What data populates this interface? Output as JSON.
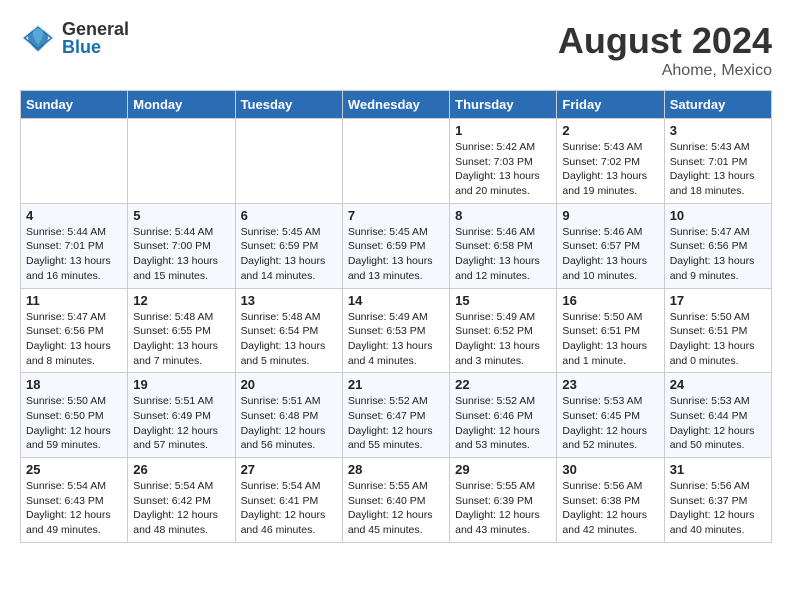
{
  "header": {
    "logo_general": "General",
    "logo_blue": "Blue",
    "month_year": "August 2024",
    "location": "Ahome, Mexico"
  },
  "days_of_week": [
    "Sunday",
    "Monday",
    "Tuesday",
    "Wednesday",
    "Thursday",
    "Friday",
    "Saturday"
  ],
  "weeks": [
    [
      {
        "day": "",
        "info": ""
      },
      {
        "day": "",
        "info": ""
      },
      {
        "day": "",
        "info": ""
      },
      {
        "day": "",
        "info": ""
      },
      {
        "day": "1",
        "info": "Sunrise: 5:42 AM\nSunset: 7:03 PM\nDaylight: 13 hours\nand 20 minutes."
      },
      {
        "day": "2",
        "info": "Sunrise: 5:43 AM\nSunset: 7:02 PM\nDaylight: 13 hours\nand 19 minutes."
      },
      {
        "day": "3",
        "info": "Sunrise: 5:43 AM\nSunset: 7:01 PM\nDaylight: 13 hours\nand 18 minutes."
      }
    ],
    [
      {
        "day": "4",
        "info": "Sunrise: 5:44 AM\nSunset: 7:01 PM\nDaylight: 13 hours\nand 16 minutes."
      },
      {
        "day": "5",
        "info": "Sunrise: 5:44 AM\nSunset: 7:00 PM\nDaylight: 13 hours\nand 15 minutes."
      },
      {
        "day": "6",
        "info": "Sunrise: 5:45 AM\nSunset: 6:59 PM\nDaylight: 13 hours\nand 14 minutes."
      },
      {
        "day": "7",
        "info": "Sunrise: 5:45 AM\nSunset: 6:59 PM\nDaylight: 13 hours\nand 13 minutes."
      },
      {
        "day": "8",
        "info": "Sunrise: 5:46 AM\nSunset: 6:58 PM\nDaylight: 13 hours\nand 12 minutes."
      },
      {
        "day": "9",
        "info": "Sunrise: 5:46 AM\nSunset: 6:57 PM\nDaylight: 13 hours\nand 10 minutes."
      },
      {
        "day": "10",
        "info": "Sunrise: 5:47 AM\nSunset: 6:56 PM\nDaylight: 13 hours\nand 9 minutes."
      }
    ],
    [
      {
        "day": "11",
        "info": "Sunrise: 5:47 AM\nSunset: 6:56 PM\nDaylight: 13 hours\nand 8 minutes."
      },
      {
        "day": "12",
        "info": "Sunrise: 5:48 AM\nSunset: 6:55 PM\nDaylight: 13 hours\nand 7 minutes."
      },
      {
        "day": "13",
        "info": "Sunrise: 5:48 AM\nSunset: 6:54 PM\nDaylight: 13 hours\nand 5 minutes."
      },
      {
        "day": "14",
        "info": "Sunrise: 5:49 AM\nSunset: 6:53 PM\nDaylight: 13 hours\nand 4 minutes."
      },
      {
        "day": "15",
        "info": "Sunrise: 5:49 AM\nSunset: 6:52 PM\nDaylight: 13 hours\nand 3 minutes."
      },
      {
        "day": "16",
        "info": "Sunrise: 5:50 AM\nSunset: 6:51 PM\nDaylight: 13 hours\nand 1 minute."
      },
      {
        "day": "17",
        "info": "Sunrise: 5:50 AM\nSunset: 6:51 PM\nDaylight: 13 hours\nand 0 minutes."
      }
    ],
    [
      {
        "day": "18",
        "info": "Sunrise: 5:50 AM\nSunset: 6:50 PM\nDaylight: 12 hours\nand 59 minutes."
      },
      {
        "day": "19",
        "info": "Sunrise: 5:51 AM\nSunset: 6:49 PM\nDaylight: 12 hours\nand 57 minutes."
      },
      {
        "day": "20",
        "info": "Sunrise: 5:51 AM\nSunset: 6:48 PM\nDaylight: 12 hours\nand 56 minutes."
      },
      {
        "day": "21",
        "info": "Sunrise: 5:52 AM\nSunset: 6:47 PM\nDaylight: 12 hours\nand 55 minutes."
      },
      {
        "day": "22",
        "info": "Sunrise: 5:52 AM\nSunset: 6:46 PM\nDaylight: 12 hours\nand 53 minutes."
      },
      {
        "day": "23",
        "info": "Sunrise: 5:53 AM\nSunset: 6:45 PM\nDaylight: 12 hours\nand 52 minutes."
      },
      {
        "day": "24",
        "info": "Sunrise: 5:53 AM\nSunset: 6:44 PM\nDaylight: 12 hours\nand 50 minutes."
      }
    ],
    [
      {
        "day": "25",
        "info": "Sunrise: 5:54 AM\nSunset: 6:43 PM\nDaylight: 12 hours\nand 49 minutes."
      },
      {
        "day": "26",
        "info": "Sunrise: 5:54 AM\nSunset: 6:42 PM\nDaylight: 12 hours\nand 48 minutes."
      },
      {
        "day": "27",
        "info": "Sunrise: 5:54 AM\nSunset: 6:41 PM\nDaylight: 12 hours\nand 46 minutes."
      },
      {
        "day": "28",
        "info": "Sunrise: 5:55 AM\nSunset: 6:40 PM\nDaylight: 12 hours\nand 45 minutes."
      },
      {
        "day": "29",
        "info": "Sunrise: 5:55 AM\nSunset: 6:39 PM\nDaylight: 12 hours\nand 43 minutes."
      },
      {
        "day": "30",
        "info": "Sunrise: 5:56 AM\nSunset: 6:38 PM\nDaylight: 12 hours\nand 42 minutes."
      },
      {
        "day": "31",
        "info": "Sunrise: 5:56 AM\nSunset: 6:37 PM\nDaylight: 12 hours\nand 40 minutes."
      }
    ]
  ]
}
